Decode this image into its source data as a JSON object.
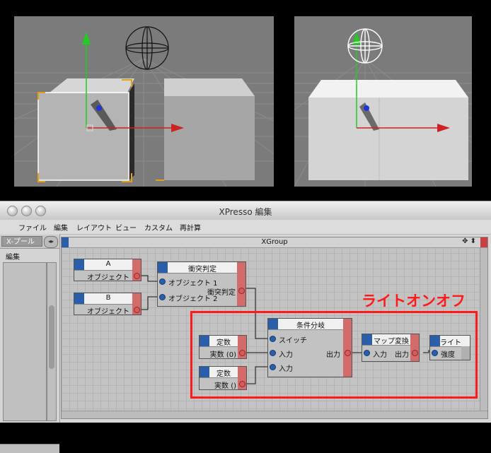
{
  "window": {
    "title": "XPresso 編集"
  },
  "menu": [
    "ファイル",
    "編集",
    "レイアウト",
    "ビュー",
    "カスタム",
    "再計算"
  ],
  "left_panel": {
    "tab": "X-プール",
    "edit": "編集"
  },
  "graph": {
    "title": "XGroup",
    "annotation": "ライトオンオフ"
  },
  "nodes": {
    "a": {
      "title": "A",
      "out": "オブジェクト"
    },
    "b": {
      "title": "B",
      "out": "オブジェクト"
    },
    "collision": {
      "title": "衝突判定",
      "in1": "オブジェクト 1",
      "in2": "オブジェクト 2",
      "out": "衝突判定"
    },
    "condition": {
      "title": "条件分岐",
      "in1": "スイッチ",
      "in2": "入力",
      "in3": "入力",
      "out": "出力"
    },
    "const1": {
      "title": "定数",
      "out": "実数 (0)"
    },
    "const2": {
      "title": "定数",
      "out": "実数 ()"
    },
    "rangemap": {
      "title": "マップ変換",
      "in": "入力",
      "out": "出力"
    },
    "light": {
      "title": "ライト",
      "in": "強度"
    }
  },
  "colors": {
    "port_in": "#2a5ea8",
    "port_out": "#d85b5b",
    "highlight": "#ff1a1a"
  }
}
